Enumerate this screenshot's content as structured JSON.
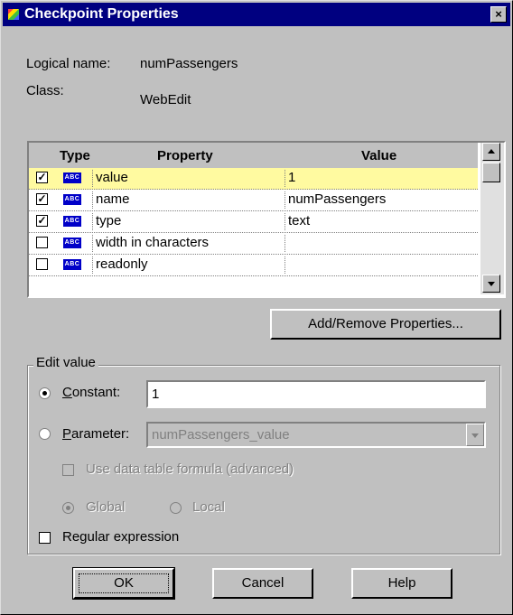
{
  "window": {
    "title": "Checkpoint Properties",
    "close_glyph": "×"
  },
  "info": {
    "logical_name_label": "Logical name:",
    "logical_name_value": "numPassengers",
    "class_label": "Class:",
    "class_value": "WebEdit"
  },
  "grid": {
    "headers": {
      "type": "Type",
      "property": "Property",
      "value": "Value"
    },
    "rows": [
      {
        "checked": true,
        "icon": "abc-string-icon",
        "property": "value",
        "value": "1",
        "selected": true
      },
      {
        "checked": true,
        "icon": "abc-string-icon",
        "property": "name",
        "value": "numPassengers",
        "selected": false
      },
      {
        "checked": true,
        "icon": "abc-string-icon",
        "property": "type",
        "value": "text",
        "selected": false
      },
      {
        "checked": false,
        "icon": "abc-string-icon",
        "property": "width in characters",
        "value": "",
        "selected": false
      },
      {
        "checked": false,
        "icon": "abc-string-icon",
        "property": "readonly",
        "value": "",
        "selected": false
      }
    ],
    "abc_badge": "ABC",
    "check_glyph": "✓"
  },
  "buttons": {
    "add_remove": "Add/Remove Properties...",
    "ok": "OK",
    "cancel": "Cancel",
    "help": "Help"
  },
  "edit_value": {
    "group_label": "Edit value",
    "constant_label": "Constant:",
    "constant_value": "1",
    "parameter_label": "Parameter:",
    "parameter_value": "numPassengers_value",
    "use_data_table_label": "Use data table formula (advanced)",
    "global_label": "Global",
    "local_label": "Local",
    "regex_label": "Regular expression"
  },
  "colors": {
    "titlebar": "#000080",
    "selected_row": "#fffaa0",
    "abc_badge": "#0000c8",
    "dialog_face": "#c0c0c0"
  }
}
